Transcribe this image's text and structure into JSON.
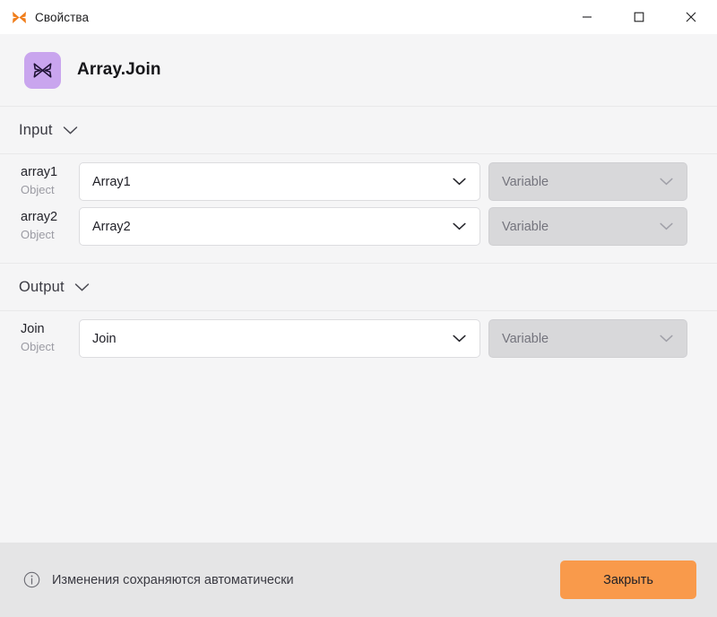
{
  "window": {
    "title": "Свойства",
    "app_icon": "butterfly-icon",
    "controls": {
      "minimize": "minimize-icon",
      "maximize": "maximize-icon",
      "close": "close-icon"
    }
  },
  "node": {
    "icon": "butterfly-node-icon",
    "icon_bg": "#c9a5ee",
    "title": "Array.Join"
  },
  "sections": [
    {
      "label": "Input",
      "toggle_icon": "chevron-down-icon",
      "rows": [
        {
          "name": "array1",
          "type": "Object",
          "value": "Array1",
          "value_icon": "chevron-down-icon",
          "source": "Variable",
          "source_icon": "chevron-down-icon"
        },
        {
          "name": "array2",
          "type": "Object",
          "value": "Array2",
          "value_icon": "chevron-down-icon",
          "source": "Variable",
          "source_icon": "chevron-down-icon"
        }
      ]
    },
    {
      "label": "Output",
      "toggle_icon": "chevron-down-icon",
      "rows": [
        {
          "name": "Join",
          "type": "Object",
          "value": "Join",
          "value_icon": "chevron-down-icon",
          "source": "Variable",
          "source_icon": "chevron-down-icon"
        }
      ]
    }
  ],
  "footer": {
    "info_icon": "info-circle-icon",
    "note": "Изменения сохраняются автоматически",
    "close_label": "Закрыть",
    "accent": "#f99a4b"
  }
}
